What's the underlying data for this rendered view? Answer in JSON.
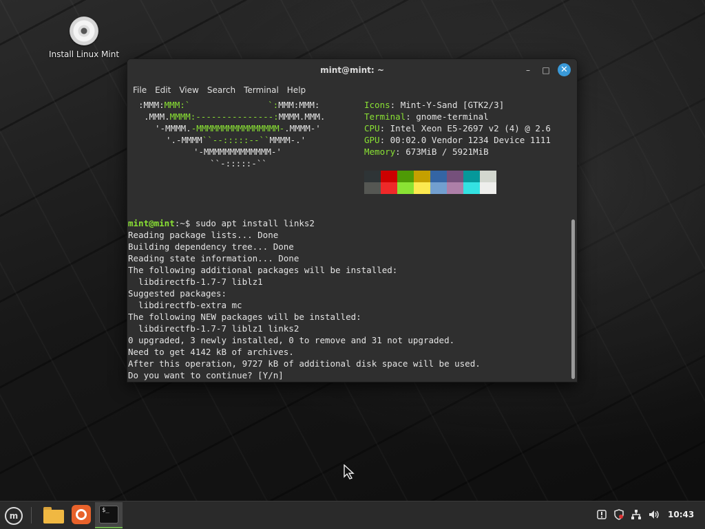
{
  "desktop": {
    "icon_label": "Install Linux Mint"
  },
  "window": {
    "title": "mint@mint: ~",
    "menu": [
      "File",
      "Edit",
      "View",
      "Search",
      "Terminal",
      "Help"
    ],
    "controls": {
      "minimize": "–",
      "maximize": "□",
      "close": "✕"
    }
  },
  "terminal": {
    "ascii_art": [
      {
        "parts": [
          {
            "t": ":MMM:",
            "c": "w"
          },
          {
            "t": "MMM:`               `:",
            "c": "g"
          },
          {
            "t": "MMM:MMM:",
            "c": "w"
          }
        ]
      },
      {
        "parts": [
          {
            "t": ".MMM.",
            "c": "w"
          },
          {
            "t": "MMMM:---------------:",
            "c": "g"
          },
          {
            "t": "MMMM.MMM.",
            "c": "w"
          }
        ]
      },
      {
        "parts": [
          {
            "t": "'-MMMM.",
            "c": "w"
          },
          {
            "t": "-MMMMMMMMMMMMMMMM-",
            "c": "g"
          },
          {
            "t": ".MMMM-'",
            "c": "w"
          }
        ]
      },
      {
        "parts": [
          {
            "t": "'.-MMMM",
            "c": "w"
          },
          {
            "t": "``--:::::--``",
            "c": "g"
          },
          {
            "t": "MMMM-.'",
            "c": "w"
          }
        ]
      },
      {
        "parts": [
          {
            "t": "'-MMMMMMMMMMMMM-'",
            "c": "w"
          }
        ]
      },
      {
        "parts": [
          {
            "t": "``-:::::-``",
            "c": "w"
          }
        ]
      }
    ],
    "info": [
      {
        "key": "Icons",
        "value": "Mint-Y-Sand [GTK2/3]"
      },
      {
        "key": "Terminal",
        "value": "gnome-terminal"
      },
      {
        "key": "CPU",
        "value": "Intel Xeon E5-2697 v2 (4) @ 2.6"
      },
      {
        "key": "GPU",
        "value": "00:02.0 Vendor 1234 Device 1111"
      },
      {
        "key": "Memory",
        "value": "673MiB / 5921MiB"
      }
    ],
    "palette_top": [
      "#2e3436",
      "#cc0000",
      "#4e9a06",
      "#c4a000",
      "#3465a4",
      "#75507b",
      "#06989a",
      "#d3d7cf"
    ],
    "palette_bottom": [
      "#555753",
      "#ef2929",
      "#8ae234",
      "#fce94f",
      "#729fcf",
      "#ad7fa8",
      "#34e2e2",
      "#eeeeec"
    ],
    "prompt_user": "mint@mint",
    "prompt_path": ":~$ ",
    "command": "sudo apt install links2",
    "output": [
      "Reading package lists... Done",
      "Building dependency tree... Done",
      "Reading state information... Done",
      "The following additional packages will be installed:",
      "  libdirectfb-1.7-7 liblz1",
      "Suggested packages:",
      "  libdirectfb-extra mc",
      "The following NEW packages will be installed:",
      "  libdirectfb-1.7-7 liblz1 links2",
      "0 upgraded, 3 newly installed, 0 to remove and 31 not upgraded.",
      "Need to get 4142 kB of archives.",
      "After this operation, 9727 kB of additional disk space will be used.",
      "Do you want to continue? [Y/n]"
    ]
  },
  "taskbar": {
    "menu_icon": "mint-logo-icon",
    "apps": [
      "folder-icon",
      "firefox-icon",
      "terminal-icon"
    ],
    "terminal_glyph": "$_",
    "tray": [
      "update-manager-icon",
      "shield-icon",
      "network-icon",
      "volume-icon"
    ],
    "clock": "10:43"
  },
  "colors": {
    "prompt_green": "#8ae234",
    "close_button": "#3a9ad9",
    "terminal_bg": "#2f2f2f"
  }
}
